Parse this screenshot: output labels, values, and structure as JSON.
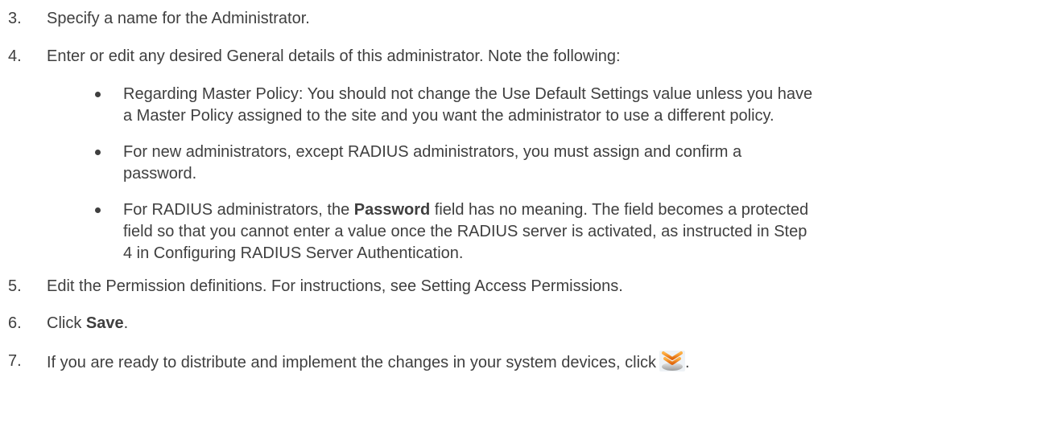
{
  "steps": [
    {
      "num": "3.",
      "text": "Specify a name for the Administrator."
    },
    {
      "num": "4.",
      "text": "Enter or edit any desired General details of this administrator. Note the following:"
    },
    {
      "num": "5.",
      "text": "Edit the Permission definitions. For instructions, see Setting Access Permissions."
    },
    {
      "num": "6.",
      "pre": "Click ",
      "bold": "Save",
      "post": "."
    },
    {
      "num": "7.",
      "text": "If you are ready to distribute and implement the changes in your system devices, click",
      "post": "."
    }
  ],
  "bullets": [
    {
      "line1": "Regarding Master Policy: You should not change the Use Default Settings value unless you have",
      "line2": "a Master Policy assigned to the site and you want the administrator to use a different policy."
    },
    {
      "line1": "For new administrators, except RADIUS administrators, you must assign and confirm a",
      "line2": "password."
    },
    {
      "line1_pre": "For RADIUS administrators, the ",
      "line1_bold": "Password",
      "line1_post": " field has no meaning. The field becomes a protected",
      "line2": "field so that you cannot enter a value once the RADIUS server is activated, as instructed in Step",
      "line3": "4 in Configuring RADIUS Server Authentication."
    }
  ],
  "icons": {
    "distribute": "distribute-changes-icon"
  },
  "colors": {
    "text": "#3f3f3f",
    "icon_orange": "#f07a10",
    "icon_gray": "#b8b8b8"
  }
}
